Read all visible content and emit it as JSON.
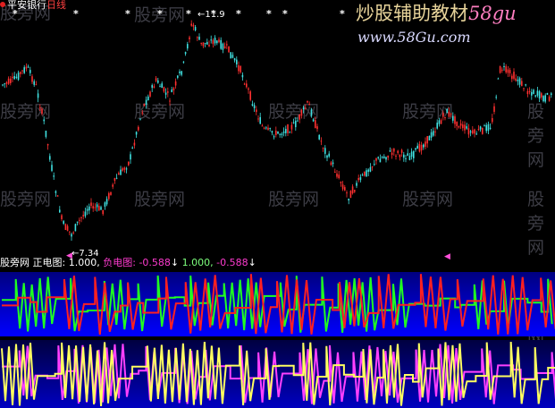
{
  "stock": {
    "name": "平安银行",
    "period": "日线"
  },
  "brand": {
    "site_name_part1": "炒股辅助教材",
    "site_name_part2": "58gu",
    "url": "www.58Gu.com"
  },
  "watermark": "股旁网",
  "price_chart": {
    "high_label": "←11.9",
    "low_label": "←7.34",
    "top_markers": [
      "*",
      "*",
      "*",
      "*",
      "*",
      "*",
      "*",
      "*",
      "*",
      "*",
      "*",
      "*",
      "*",
      "*"
    ]
  },
  "indicator": {
    "source": "股旁网",
    "pos_label": "正电图:",
    "pos_value": "1.000,",
    "neg_label": "负电图:",
    "neg_value": "-0.588",
    "value3": "1.000,",
    "value4": "-0.588",
    "down_arrow": "↓"
  },
  "colors": {
    "background": "#000000",
    "candle_up": "#ff3030",
    "candle_down": "#40e0e0",
    "upper_panel_fill": "#0000ff",
    "upper_line_red": "#ff2020",
    "upper_line_green": "#20ff20",
    "lower_line_yellow": "#ffff60",
    "lower_line_magenta": "#ff40ff"
  }
}
